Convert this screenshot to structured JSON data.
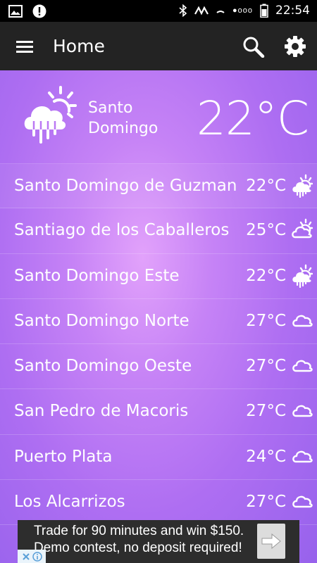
{
  "status_bar": {
    "time": "22:54",
    "signal_dots": "●ooo",
    "icons": [
      "image-icon",
      "alert-icon",
      "bluetooth-icon",
      "nfc-icon",
      "wifi-icon",
      "battery-icon"
    ]
  },
  "app_bar": {
    "title": "Home",
    "icons": [
      "menu-icon",
      "search-icon",
      "settings-icon"
    ]
  },
  "current": {
    "city_line1": "Santo",
    "city_line2": "Domingo",
    "temperature": "22°C",
    "icon": "partly-sunny-rain-icon"
  },
  "cities": [
    {
      "name": "Santo Domingo de Guzman",
      "temp": "22°C",
      "icon": "partly-sunny-rain-icon"
    },
    {
      "name": "Santiago de los Caballeros",
      "temp": "25°C",
      "icon": "partly-sunny-icon"
    },
    {
      "name": "Santo Domingo Este",
      "temp": "22°C",
      "icon": "partly-sunny-rain-icon"
    },
    {
      "name": "Santo Domingo Norte",
      "temp": "27°C",
      "icon": "cloud-icon"
    },
    {
      "name": "Santo Domingo Oeste",
      "temp": "27°C",
      "icon": "cloud-icon"
    },
    {
      "name": "San Pedro de Macoris",
      "temp": "27°C",
      "icon": "cloud-icon"
    },
    {
      "name": "Puerto Plata",
      "temp": "24°C",
      "icon": "cloud-icon"
    },
    {
      "name": "Los Alcarrizos",
      "temp": "27°C",
      "icon": "cloud-icon"
    }
  ],
  "ad": {
    "line1": "Trade for 90 minutes and win $150.",
    "line2": "Demo contest, no deposit required!"
  },
  "colors": {
    "app_bar": "#232323",
    "background_light": "#e2a2fb",
    "background_dark": "#9762ec",
    "text": "#ffffff"
  }
}
